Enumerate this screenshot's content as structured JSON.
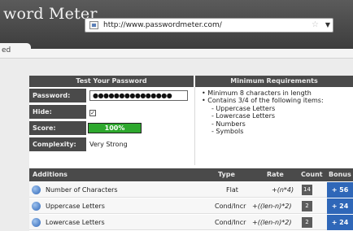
{
  "window": {
    "title": "word Meter",
    "url": "http://www.passwordmeter.com/",
    "tab_fragment": "ed"
  },
  "test_panel": {
    "heading": "Test Your Password",
    "password_label": "Password:",
    "password_mask": "●●●●●●●●●●●●●●●",
    "hide_label": "Hide:",
    "hide_checked": "✓",
    "score_label": "Score:",
    "score_value": "100%",
    "score_fraction": 1.0,
    "complexity_label": "Complexity:",
    "complexity_value": "Very Strong"
  },
  "requirements": {
    "heading": "Minimum Requirements",
    "line1": "• Minimum 8 characters in length",
    "line2": "• Contains 3/4 of the following items:",
    "items": [
      "- Uppercase Letters",
      "- Lowercase Letters",
      "- Numbers",
      "- Symbols"
    ]
  },
  "additions": {
    "headers": {
      "name": "Additions",
      "type": "Type",
      "rate": "Rate",
      "count": "Count",
      "bonus": "Bonus"
    },
    "rows": [
      {
        "name": "Number of Characters",
        "type": "Flat",
        "rate": "+(n*4)",
        "count": "14",
        "bonus": "+ 56"
      },
      {
        "name": "Uppercase Letters",
        "type": "Cond/Incr",
        "rate": "+((len-n)*2)",
        "count": "2",
        "bonus": "+ 24"
      },
      {
        "name": "Lowercase Letters",
        "type": "Cond/Incr",
        "rate": "+((len-n)*2)",
        "count": "2",
        "bonus": "+ 24"
      }
    ]
  },
  "colors": {
    "header_dark": "#4a4a4a",
    "score_green": "#2ea82e",
    "bonus_blue": "#2f67b8"
  }
}
